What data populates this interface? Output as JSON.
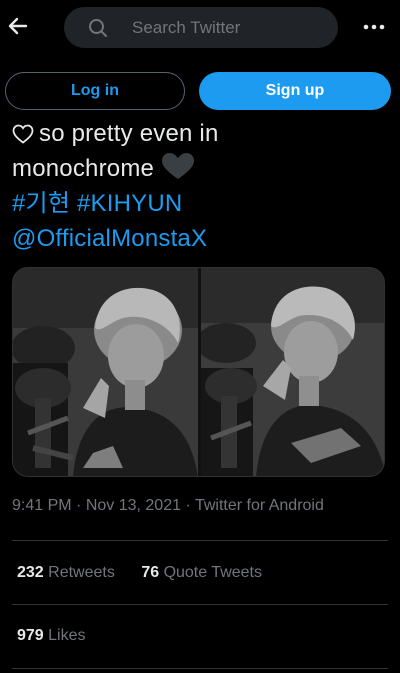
{
  "topbar": {
    "back_icon": "arrow-left-icon",
    "search_placeholder": "Search Twitter",
    "search_icon": "search-icon",
    "more_icon": "more-dots-icon"
  },
  "auth": {
    "login_label": "Log in",
    "signup_label": "Sign up"
  },
  "tweet": {
    "line1_text": "so pretty even in",
    "line2_text": "monochrome",
    "hashtags": "#기현 #KIHYUN",
    "mention": "@OfficialMonstaX"
  },
  "meta": {
    "time": "9:41 PM",
    "sep1": " · ",
    "date": "Nov 13, 2021",
    "sep2": " · ",
    "source": "Twitter for Android"
  },
  "stats": {
    "retweets_count": "232",
    "retweets_label": "Retweets",
    "quote_count": "76",
    "quote_label": "Quote Tweets",
    "likes_count": "979",
    "likes_label": "Likes"
  },
  "colors": {
    "accent": "#1d9bf0",
    "background": "#000000",
    "muted": "#71767b"
  }
}
